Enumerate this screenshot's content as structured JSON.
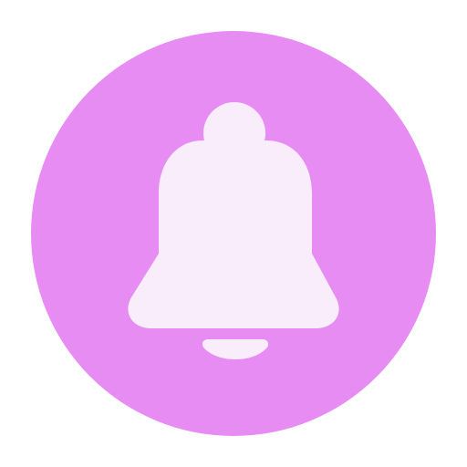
{
  "icon": {
    "name": "bell-icon",
    "background_color": "#E68CF2",
    "foreground_color": "#F9EDFC"
  }
}
